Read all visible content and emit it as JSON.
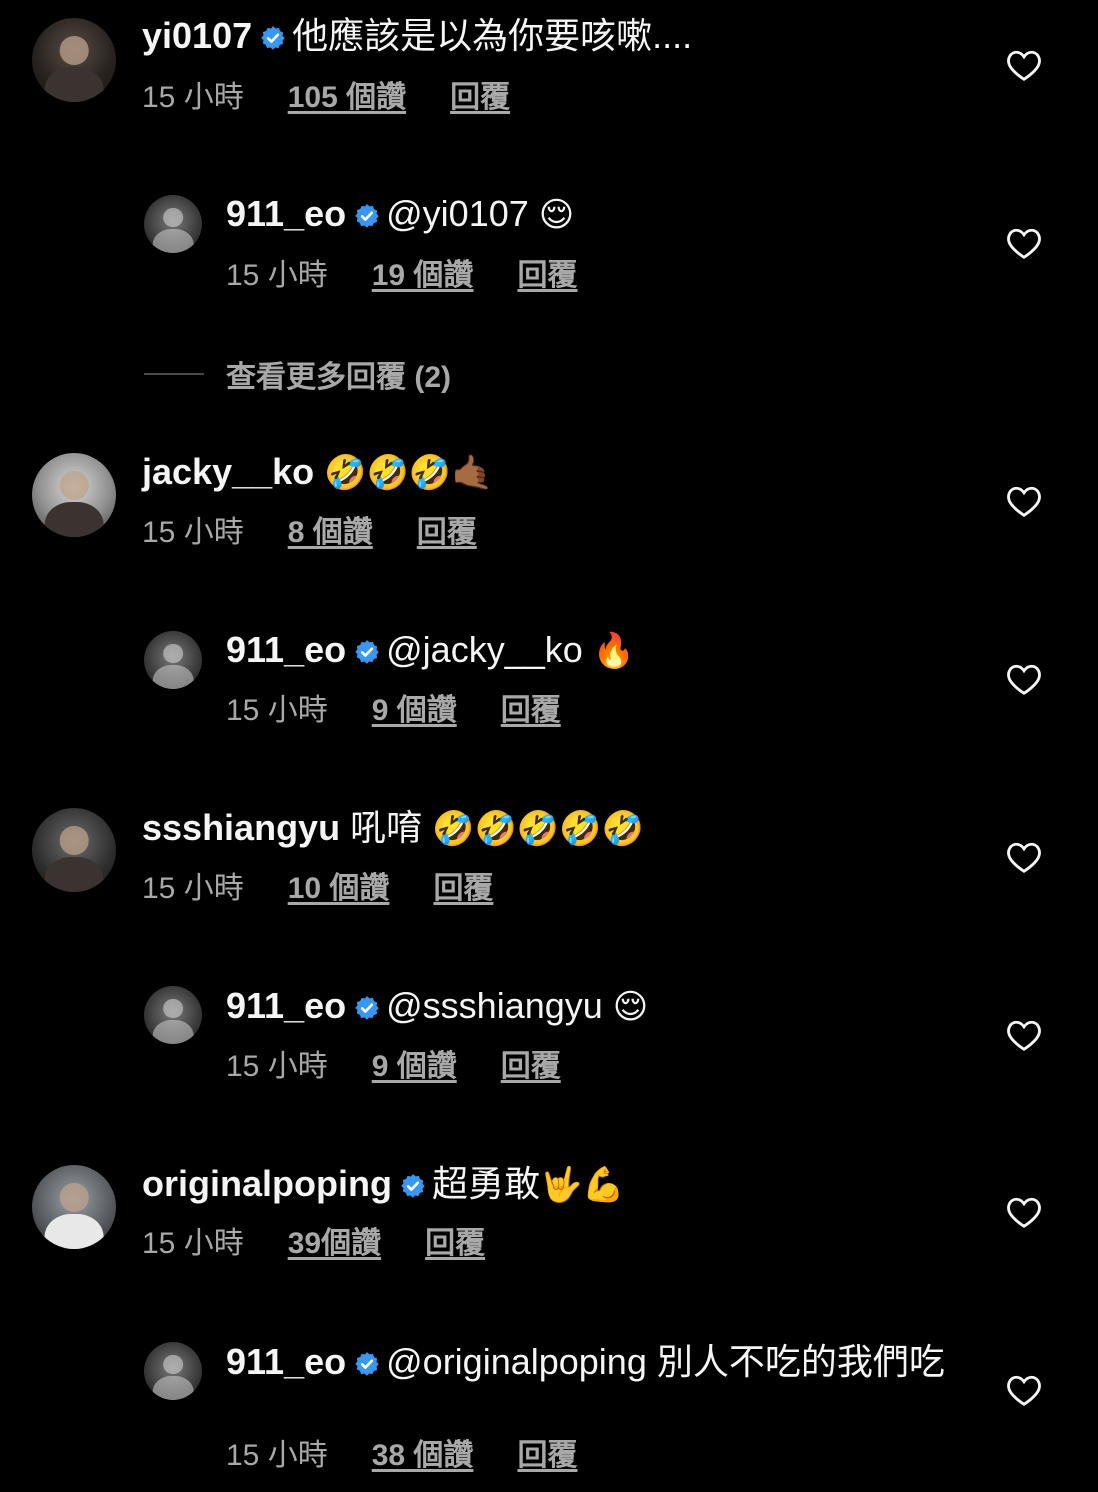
{
  "colors": {
    "background": "#000000",
    "text": "#f5f5f5",
    "meta": "#a8a8a8",
    "verified": "#3897f0"
  },
  "comments": [
    {
      "username": "yi0107",
      "verified": true,
      "text": "他應該是以為你要咳嗽....",
      "time": "15 小時",
      "likes": "105 個讚",
      "reply": "回覆"
    },
    {
      "username": "911_eo",
      "verified": true,
      "text": "@yi0107",
      "emoji": "😌",
      "time": "15 小時",
      "likes": "19 個讚",
      "reply": "回覆"
    },
    {
      "username": "jacky__ko",
      "verified": false,
      "text": "",
      "emoji": "🤣🤣🤣🤙🏾",
      "time": "15 小時",
      "likes": "8 個讚",
      "reply": "回覆"
    },
    {
      "username": "911_eo",
      "verified": true,
      "text": "@jacky__ko",
      "emoji": "🔥",
      "time": "15 小時",
      "likes": "9 個讚",
      "reply": "回覆"
    },
    {
      "username": "ssshiangyu",
      "verified": false,
      "text": "吼唷",
      "emoji": "🤣🤣🤣🤣🤣",
      "time": "15 小時",
      "likes": "10 個讚",
      "reply": "回覆"
    },
    {
      "username": "911_eo",
      "verified": true,
      "text": "@ssshiangyu",
      "emoji": "😌",
      "time": "15 小時",
      "likes": "9 個讚",
      "reply": "回覆"
    },
    {
      "username": "originalpoping",
      "verified": true,
      "text": "超勇敢",
      "emoji": "🤟💪",
      "time": "15 小時",
      "likes": "39個讚",
      "reply": "回覆"
    },
    {
      "username": "911_eo",
      "verified": true,
      "text": "@originalpoping 別人不吃的我們吃",
      "time": "15 小時",
      "likes": "38 個讚",
      "reply": "回覆"
    }
  ],
  "view_more_replies": "查看更多回覆 (2)",
  "icons": {
    "verified": "verified-badge-icon",
    "like": "heart-icon"
  }
}
